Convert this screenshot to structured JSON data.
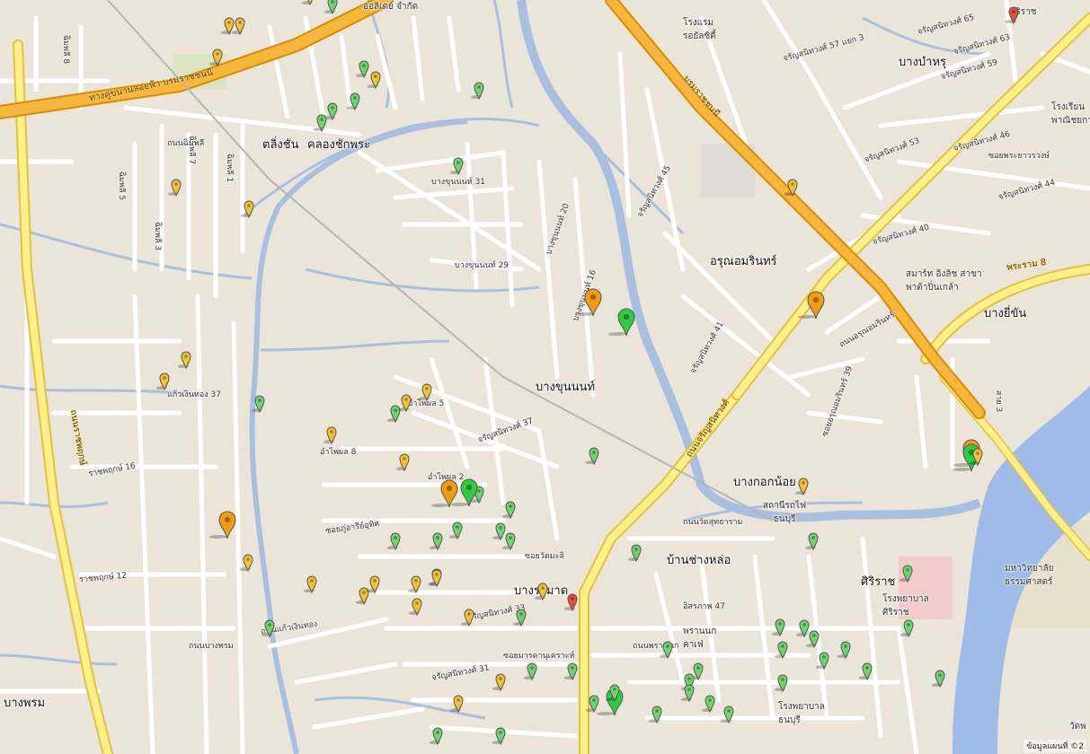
{
  "map": {
    "attribution": "ข้อมูลแผนที่ ©2",
    "districts": [
      {
        "name": "ตลิ่งชัน"
      },
      {
        "name": "คลองชักพระ"
      },
      {
        "name": "บางบำหรุ"
      },
      {
        "name": "อรุณอมรินทร์"
      },
      {
        "name": "บางยี่ขัน"
      },
      {
        "name": "บางขุนนนท์"
      },
      {
        "name": "บางกอกน้อย"
      },
      {
        "name": "บ้านช่างหล่อ"
      },
      {
        "name": "บางระมาด"
      },
      {
        "name": "ศิริราช"
      },
      {
        "name": "บางพรม"
      }
    ],
    "roads": [
      {
        "name": "ทางคู่ขนานลอยฟ้า บรมราชชนนี"
      },
      {
        "name": "บรมราชชนนี"
      },
      {
        "name": "ถนนราชพฤกษ์"
      },
      {
        "name": "ถนนจรัญสนิทวงศ์"
      },
      {
        "name": "พระราม 8"
      },
      {
        "name": "ถนนบางพรม"
      },
      {
        "name": "ถนนพรานนก"
      },
      {
        "name": "ถนนอรุณอมรินทร์"
      }
    ],
    "streets": [
      {
        "name": "ฉิมพลี 8"
      },
      {
        "name": "ฉิมพลี 7"
      },
      {
        "name": "ฉิมพลี 5"
      },
      {
        "name": "ฉิมพลี 1"
      },
      {
        "name": "ฉิมพลี 3"
      },
      {
        "name": "ถนนฉิมพลี"
      },
      {
        "name": "บางขุนนนท์ 31"
      },
      {
        "name": "บางขุนนนท์ 29"
      },
      {
        "name": "บางขุนนนท์ 20"
      },
      {
        "name": "บางขุนนนท์ 16"
      },
      {
        "name": "จรัญสนิทวงศ์ 65"
      },
      {
        "name": "จรัญสนิทวงศ์ 63"
      },
      {
        "name": "จรัญสนิทวงศ์ 57 แยก 3"
      },
      {
        "name": "จรัญสนิทวงศ์ 59"
      },
      {
        "name": "จรัญสนิทวงศ์ 53"
      },
      {
        "name": "จรัญสนิทวงศ์ 46"
      },
      {
        "name": "จรัญสนิทวงศ์ 44"
      },
      {
        "name": "จรัญสนิทวงศ์ 40"
      },
      {
        "name": "จรัญสนิทวงศ์ 45"
      },
      {
        "name": "จรัญสนิทวงศ์ 41"
      },
      {
        "name": "จรัญสนิทวงศ์ 37"
      },
      {
        "name": "จรัญสนิทวงศ์ 33"
      },
      {
        "name": "จรัญสนิทวงศ์ 31"
      },
      {
        "name": "อำไพผล 8"
      },
      {
        "name": "อำไพผล 2"
      },
      {
        "name": "อำไพผล 5"
      },
      {
        "name": "ซอยภู่อารีย์อุทิศ"
      },
      {
        "name": "ซอยวัดมะลิ"
      },
      {
        "name": "ราชพฤกษ์ 16"
      },
      {
        "name": "ราชพฤกษ์ 12"
      },
      {
        "name": "แก้วเงินทอง 37"
      },
      {
        "name": "ถนนแก้วเงินทอง"
      },
      {
        "name": "ซอยมารดานุเคราะห์"
      },
      {
        "name": "ซอยอรุณอมรินทร์ 39"
      },
      {
        "name": "ถนนวัดสุทธาราม"
      },
      {
        "name": "อิสรภาพ 47"
      },
      {
        "name": "ซอยพระยาวรวงษ์"
      },
      {
        "name": "สาย 3"
      }
    ],
    "pois": [
      {
        "name": "สถานีรถไฟ ธนบุรี"
      },
      {
        "name": "โรงพยาบาล ศิริราช"
      },
      {
        "name": "โรงพยาบาล ธนบุรี"
      },
      {
        "name": "มหาวิทยาลัย ธรรมศาสตร์"
      },
      {
        "name": "สมาร์ท อิงลิช สาขาพาต้าปิ่นเกล้า"
      },
      {
        "name": "โรงแรม รอยัลซิตี้"
      },
      {
        "name": "ออลิเดย์ จำกัด"
      },
      {
        "name": "โรงเรียน พาณิชยการ"
      },
      {
        "name": "พรานนก คาเฟ่"
      },
      {
        "name": "วัดพ"
      },
      {
        "name": "ศิริราช"
      }
    ],
    "marker_types": {
      "yellow": "#f1c232",
      "orange": "#f39c12",
      "green": "#6fd36f",
      "bright-green": "#2ecc40",
      "red": "#e74c3c"
    },
    "markers": [
      {
        "type": "yellow"
      },
      {
        "type": "green"
      },
      {
        "type": "yellow"
      },
      {
        "type": "yellow"
      },
      {
        "type": "yellow"
      },
      {
        "type": "green"
      },
      {
        "type": "yellow"
      },
      {
        "type": "green"
      },
      {
        "type": "green"
      },
      {
        "type": "green"
      },
      {
        "type": "green"
      },
      {
        "type": "green"
      },
      {
        "type": "yellow"
      },
      {
        "type": "yellow"
      },
      {
        "type": "yellow"
      },
      {
        "type": "yellow"
      },
      {
        "type": "green"
      },
      {
        "type": "green"
      },
      {
        "type": "yellow"
      },
      {
        "type": "yellow"
      },
      {
        "type": "yellow"
      },
      {
        "type": "yellow"
      },
      {
        "type": "orange"
      },
      {
        "type": "green"
      },
      {
        "type": "bright-green"
      },
      {
        "type": "green"
      },
      {
        "type": "green"
      },
      {
        "type": "green"
      },
      {
        "type": "green"
      },
      {
        "type": "green"
      },
      {
        "type": "green"
      },
      {
        "type": "green"
      },
      {
        "type": "green"
      },
      {
        "type": "green"
      },
      {
        "type": "orange"
      },
      {
        "type": "yellow"
      },
      {
        "type": "yellow"
      },
      {
        "type": "yellow"
      },
      {
        "type": "yellow"
      },
      {
        "type": "yellow"
      },
      {
        "type": "yellow"
      },
      {
        "type": "yellow"
      },
      {
        "type": "yellow"
      },
      {
        "type": "green"
      },
      {
        "type": "yellow"
      },
      {
        "type": "red"
      },
      {
        "type": "orange"
      },
      {
        "type": "bright-green"
      },
      {
        "type": "orange"
      },
      {
        "type": "yellow"
      },
      {
        "type": "orange"
      },
      {
        "type": "yellow"
      },
      {
        "type": "green"
      },
      {
        "type": "green"
      },
      {
        "type": "green"
      },
      {
        "type": "green"
      },
      {
        "type": "green"
      },
      {
        "type": "green"
      },
      {
        "type": "green"
      },
      {
        "type": "green"
      },
      {
        "type": "green"
      },
      {
        "type": "green"
      },
      {
        "type": "green"
      },
      {
        "type": "green"
      },
      {
        "type": "bright-green"
      },
      {
        "type": "green"
      },
      {
        "type": "green"
      },
      {
        "type": "green"
      },
      {
        "type": "green"
      },
      {
        "type": "green"
      },
      {
        "type": "green"
      },
      {
        "type": "green"
      },
      {
        "type": "green"
      },
      {
        "type": "green"
      },
      {
        "type": "yellow"
      },
      {
        "type": "green"
      },
      {
        "type": "red"
      },
      {
        "type": "bright-green"
      },
      {
        "type": "yellow"
      },
      {
        "type": "yellow"
      },
      {
        "type": "green"
      },
      {
        "type": "green"
      },
      {
        "type": "green"
      },
      {
        "type": "green"
      }
    ]
  }
}
